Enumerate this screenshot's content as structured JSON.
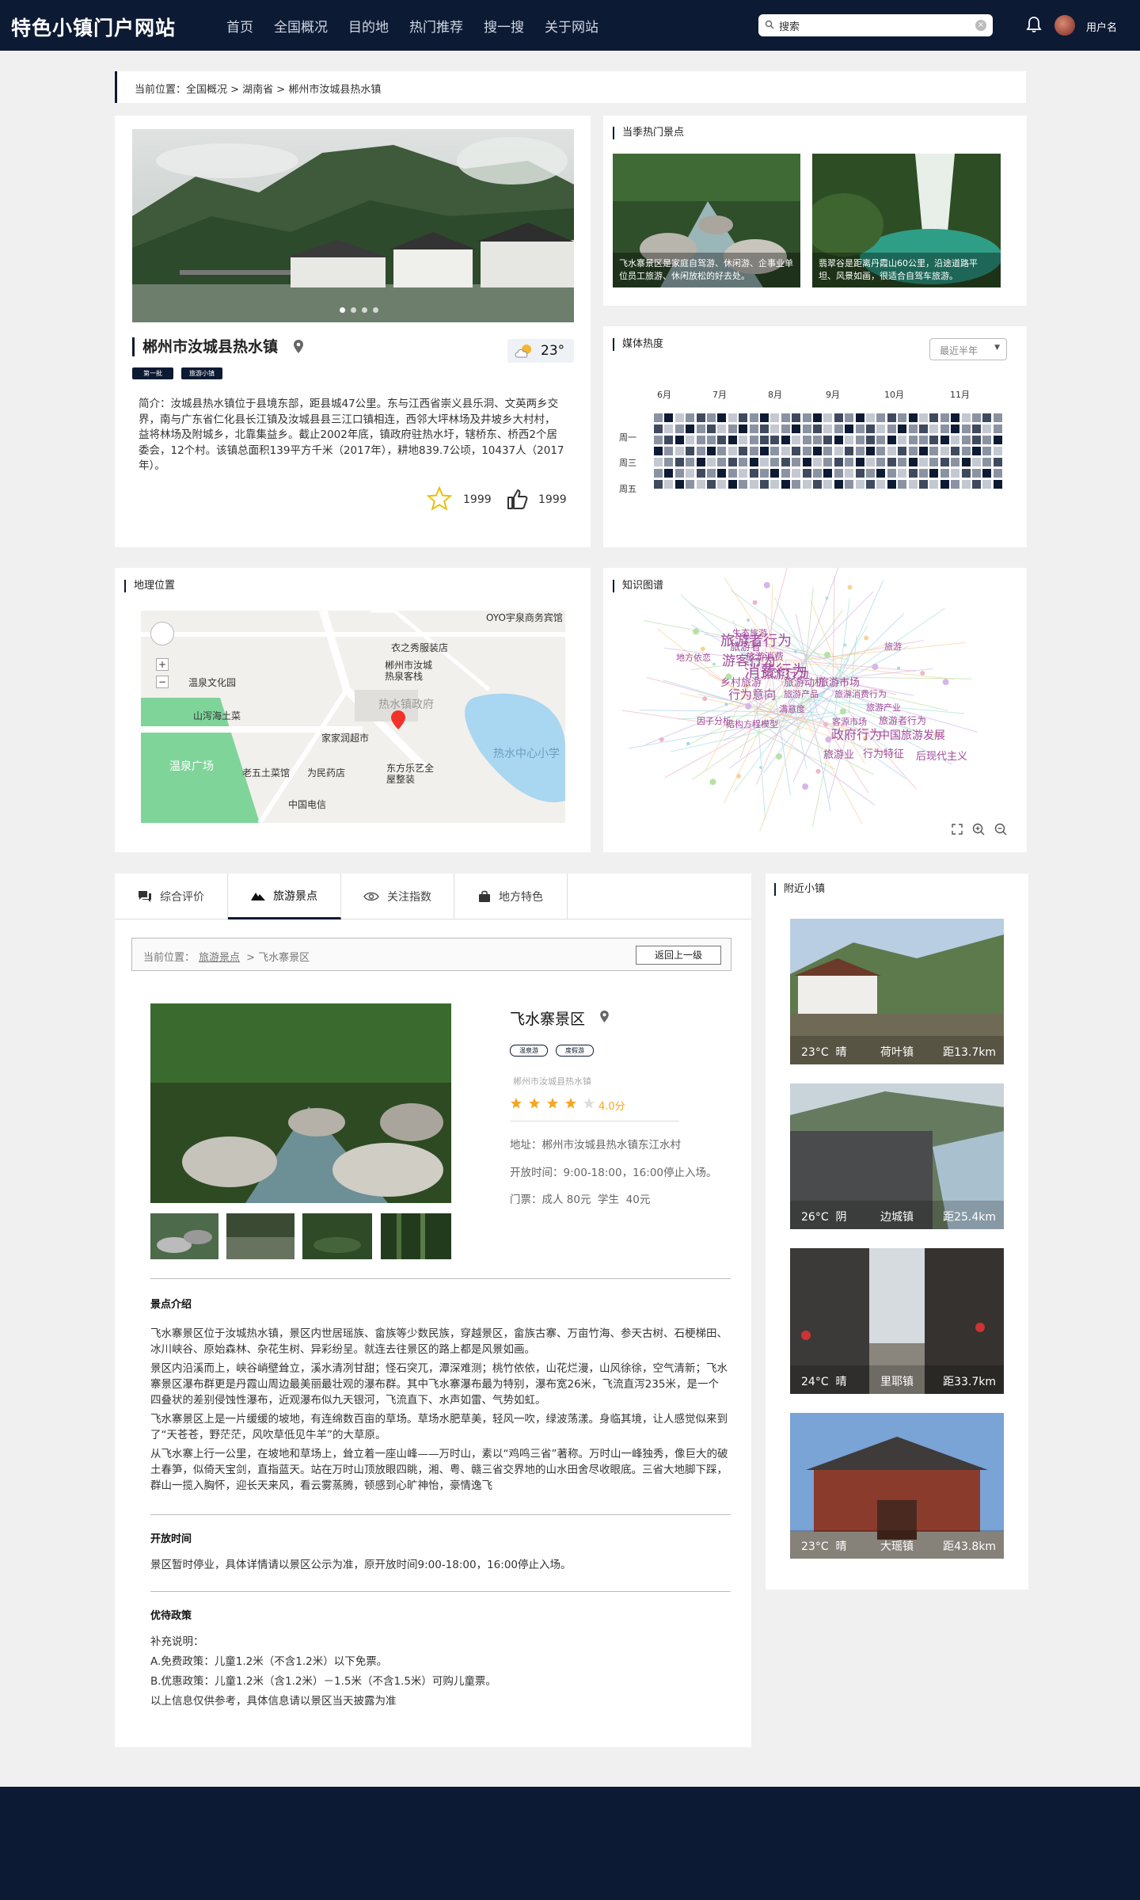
{
  "header": {
    "site_title": "特色小镇门户网站",
    "nav": [
      "首页",
      "全国概况",
      "目的地",
      "热门推荐",
      "搜一搜",
      "关于网站"
    ],
    "search_value": "搜索",
    "username": "用户名"
  },
  "breadcrumb": "当前位置：全国概况 > 湖南省 > 郴州市汝城县热水镇",
  "town": {
    "name": "郴州市汝城县热水镇",
    "tags": [
      "第一批",
      "旅游小镇"
    ],
    "temperature": "23°",
    "intro": "简介：汝城县热水镇位于县境东部，距县城47公里。东与江西省崇义县乐洞、文英两乡交界，南与广东省仁化县长江镇及汝城县县三江口镇相连，西邻大坪林场及井坡乡大村村，益将林场及附城乡，北靠集益乡。截止2002年底，镇政府驻热水圩，辖桥东、桥西2个居委会，12个村。该镇总面积139平方千米（2017年），耕地839.7公顷，10437人（2017年）。",
    "favorites": "1999",
    "likes": "1999"
  },
  "hot_spots": {
    "title": "当季热门景点",
    "items": [
      {
        "caption": "飞水寨景区是家庭自驾游、休闲游、企事业单位员工旅游、休闲放松的好去处。"
      },
      {
        "caption": "翡翠谷是距离丹霞山60公里，沿途道路平坦、风景如画，很适合自驾车旅游。"
      }
    ]
  },
  "media": {
    "title": "媒体热度",
    "range": "最近半年",
    "months": [
      "6月",
      "7月",
      "8月",
      "9月",
      "10月",
      "11月"
    ],
    "weekdays": [
      "周一",
      "周三",
      "周五"
    ],
    "heat_levels": [
      [
        2,
        4,
        1,
        2,
        3,
        2,
        4,
        1,
        3,
        2,
        4,
        1,
        2,
        3,
        2,
        4,
        1,
        3,
        2,
        4,
        1,
        2,
        3,
        2,
        4,
        1,
        3,
        2,
        4,
        1,
        2,
        3,
        2
      ],
      [
        3,
        1,
        2,
        4,
        2,
        3,
        1,
        2,
        4,
        2,
        3,
        1,
        2,
        4,
        2,
        3,
        1,
        2,
        4,
        2,
        3,
        1,
        2,
        4,
        2,
        3,
        1,
        2,
        4,
        2,
        3,
        1,
        2
      ],
      [
        2,
        3,
        4,
        1,
        2,
        2,
        3,
        4,
        1,
        2,
        3,
        3,
        4,
        1,
        2,
        2,
        3,
        4,
        1,
        2,
        3,
        2,
        4,
        1,
        2,
        2,
        3,
        4,
        1,
        2,
        3,
        2,
        4
      ],
      [
        4,
        2,
        1,
        3,
        2,
        4,
        2,
        1,
        3,
        2,
        4,
        2,
        1,
        3,
        2,
        4,
        2,
        1,
        3,
        2,
        4,
        2,
        1,
        3,
        2,
        4,
        2,
        1,
        3,
        2,
        4,
        2,
        1
      ],
      [
        1,
        2,
        3,
        2,
        4,
        1,
        2,
        3,
        2,
        4,
        1,
        2,
        3,
        2,
        4,
        1,
        2,
        3,
        2,
        4,
        1,
        2,
        3,
        2,
        4,
        1,
        2,
        3,
        2,
        4,
        1,
        2,
        3
      ],
      [
        2,
        4,
        2,
        1,
        3,
        2,
        4,
        2,
        1,
        3,
        2,
        4,
        2,
        1,
        3,
        2,
        4,
        2,
        1,
        3,
        2,
        4,
        2,
        1,
        3,
        2,
        4,
        2,
        1,
        3,
        2,
        4,
        2
      ],
      [
        3,
        1,
        4,
        2,
        1,
        3,
        1,
        4,
        2,
        1,
        3,
        1,
        4,
        2,
        1,
        3,
        1,
        4,
        2,
        1,
        3,
        1,
        4,
        2,
        1,
        3,
        1,
        4,
        2,
        1,
        3,
        1,
        4
      ]
    ]
  },
  "map": {
    "title": "地理位置",
    "labels": [
      "衣之秀服装店",
      "温泉文化园",
      "郴州市汝城热泉客栈",
      "热水镇政府",
      "山泻海土菜",
      "家家润超市",
      "老五土菜馆",
      "为民药店",
      "东方乐艺全屋整装",
      "温泉广场",
      "中国电信",
      "热水中心小学",
      "OYO宇泉商务宾馆"
    ]
  },
  "graph": {
    "title": "知识图谱",
    "words": [
      "旅游者行为",
      "消费行为",
      "旅游行为",
      "游客行为",
      "旅游者",
      "生态旅游",
      "旅游",
      "地方依恋",
      "旅游消费",
      "乡村旅游",
      "旅游动机",
      "旅游市场",
      "行为意向",
      "旅游产品",
      "旅游消费行为",
      "满意度",
      "旅游产业",
      "因子分析",
      "结构方程模型",
      "客源市场",
      "旅游者行为",
      "政府行为",
      "中国旅游发展",
      "旅游业",
      "行为特征",
      "后现代主义"
    ]
  },
  "tabs": [
    "综合评价",
    "旅游景点",
    "关注指数",
    "地方特色"
  ],
  "spot": {
    "crumb_prefix": "当前位置：",
    "crumb_link": "旅游景点",
    "crumb_rest": " > 飞水寨景区",
    "back": "返回上一级",
    "name": "飞水寨景区",
    "tags": [
      "温泉游",
      "度假游"
    ],
    "location": "郴州市汝城县热水镇",
    "rating": "4.0分",
    "stars": 4,
    "address": "地址：郴州市汝城县热水镇东江水村",
    "hours": "开放时间：9:00-18:00，16:00停止入场。",
    "ticket": "门票：成人 80元  学生  40元",
    "intro_title": "景点介绍",
    "intro_paras": [
      "飞水寨景区位于汝城热水镇，景区内世居瑶族、畲族等少数民族，穿越景区，畲族古寨、万亩竹海、参天古树、石梗梯田、冰川峡谷、原始森林、杂花生树、异彩纷呈。就连去往景区的路上都是风景如画。",
      "景区内沿溪而上，峡谷峭壁耸立，溪水清冽甘甜；怪石突兀，潭深难测；桃竹依依，山花烂漫，山风徐徐，空气清新；飞水寨景区瀑布群更是丹霞山周边最美丽最壮观的瀑布群。其中飞水寨瀑布最为特别，瀑布宽26米，飞流直泻235米，是一个四叠状的差别侵蚀性瀑布，近观瀑布似九天银河，飞流直下、水声如雷、气势如虹。",
      "飞水寨景区上是一片缓缓的坡地，有连绵数百亩的草场。草场水肥草美，轻风一吹，绿波荡漾。身临其境，让人感觉似来到了“天苍苍，野茫茫，风吹草低见牛羊”的大草原。",
      "从飞水寨上行一公里，在坡地和草场上，耸立着一座山峰——万时山，素以“鸡鸣三省”著称。万时山一峰独秀，像巨大的破土春笋，似倚天宝剑，直指蓝天。站在万时山顶放眼四眺，湘、粤、赣三省交界地的山水田舍尽收眼底。三省大地脚下踩，群山一揽入胸怀，迎长天来风，看云雾蒸腾，顿感到心旷神怡，豪情逸飞"
    ],
    "open_title": "开放时间",
    "open_text": "景区暂时停业，具体详情请以景区公示为准，原开放时间9:00-18:00，16:00停止入场。",
    "policy_title": "优待政策",
    "policy_lines": [
      "补充说明：",
      "A.免费政策：儿童1.2米（不含1.2米）以下免票。",
      "B.优惠政策：儿童1.2米（含1.2米）－1.5米（不含1.5米）可购儿童票。",
      "以上信息仅供参考，具体信息请以景区当天披露为准"
    ]
  },
  "nearby": {
    "title": "附近小镇",
    "towns": [
      {
        "weather": "23°C  晴",
        "name": "荷叶镇",
        "dist": "距13.7km"
      },
      {
        "weather": "26°C  阴",
        "name": "边城镇",
        "dist": "距25.4km"
      },
      {
        "weather": "24°C  晴",
        "name": "里耶镇",
        "dist": "距33.7km"
      },
      {
        "weather": "23°C  晴",
        "name": "大瑶镇",
        "dist": "距43.8km"
      }
    ]
  },
  "colors": {
    "primary": "#0c1a33",
    "star": "#f5a623",
    "heat_1": "#c3c8d1",
    "heat_2": "#8b93a2",
    "heat_3": "#3f4a5e",
    "heat_4": "#0c1a33"
  }
}
